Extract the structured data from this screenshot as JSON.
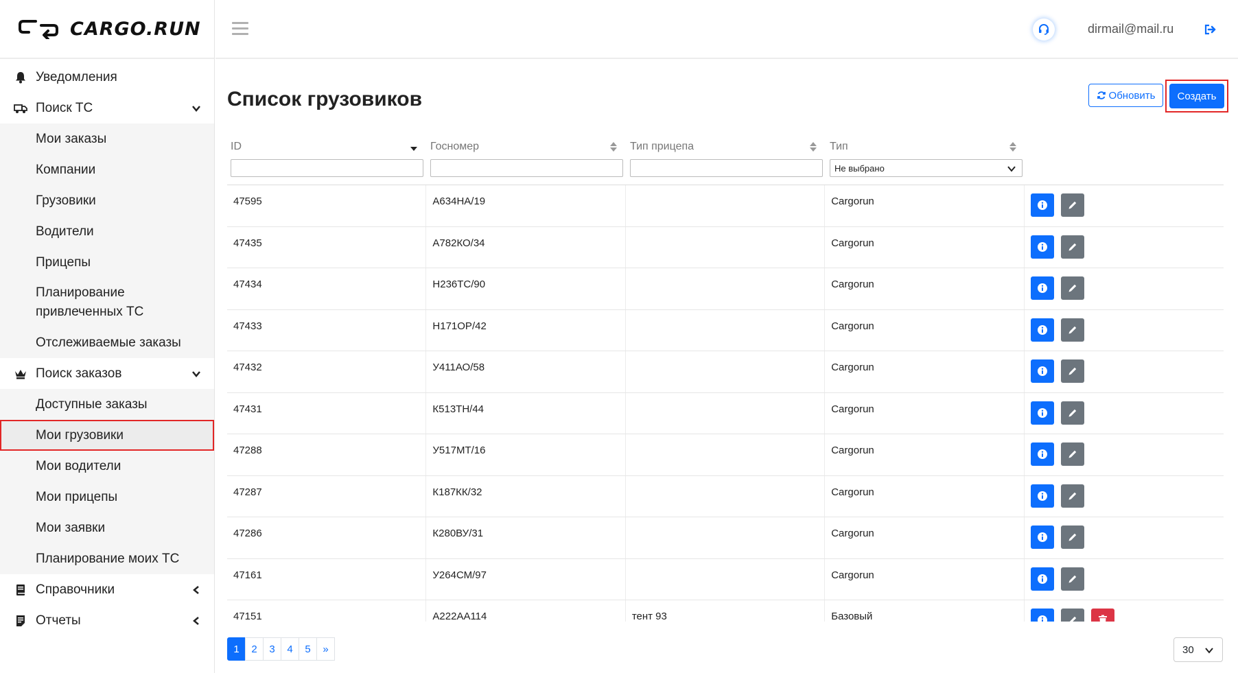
{
  "brand": {
    "name": "CARGO.RUN"
  },
  "sidebar": {
    "items": [
      {
        "label": "Уведомления",
        "icon": "bell-icon"
      },
      {
        "label": "Поиск ТС",
        "icon": "truck-search-icon",
        "expanded": true,
        "children": [
          "Мои заказы",
          "Компании",
          "Грузовики",
          "Водители",
          "Прицепы",
          "Планирование привлеченных ТС",
          "Отслеживаемые заказы"
        ]
      },
      {
        "label": "Поиск заказов",
        "icon": "crown-icon",
        "expanded": true,
        "children": [
          "Доступные заказы",
          "Мои грузовики",
          "Мои водители",
          "Мои прицепы",
          "Мои заявки",
          "Планирование моих ТС"
        ]
      },
      {
        "label": "Справочники",
        "icon": "book-icon",
        "expanded": false
      },
      {
        "label": "Отчеты",
        "icon": "report-icon",
        "expanded": false
      }
    ],
    "active_item": "Мои грузовики"
  },
  "header": {
    "user_email": "dirmail@mail.ru"
  },
  "page": {
    "title": "Список грузовиков",
    "refresh_label": "Обновить",
    "create_label": "Создать"
  },
  "table": {
    "columns": [
      "ID",
      "Госномер",
      "Тип прицепа",
      "Тип"
    ],
    "type_filter_value": "Не выбрано",
    "rows": [
      {
        "id": "47595",
        "plate": "А634НА/19",
        "trailer": "",
        "type": "Cargorun"
      },
      {
        "id": "47435",
        "plate": "А782КО/34",
        "trailer": "",
        "type": "Cargorun"
      },
      {
        "id": "47434",
        "plate": "Н236ТС/90",
        "trailer": "",
        "type": "Cargorun"
      },
      {
        "id": "47433",
        "plate": "Н171ОР/42",
        "trailer": "",
        "type": "Cargorun"
      },
      {
        "id": "47432",
        "plate": "У411АО/58",
        "trailer": "",
        "type": "Cargorun"
      },
      {
        "id": "47431",
        "plate": "К513ТН/44",
        "trailer": "",
        "type": "Cargorun"
      },
      {
        "id": "47288",
        "plate": "У517МТ/16",
        "trailer": "",
        "type": "Cargorun"
      },
      {
        "id": "47287",
        "plate": "К187КК/32",
        "trailer": "",
        "type": "Cargorun"
      },
      {
        "id": "47286",
        "plate": "К280ВУ/31",
        "trailer": "",
        "type": "Cargorun"
      },
      {
        "id": "47161",
        "plate": "У264СМ/97",
        "trailer": "",
        "type": "Cargorun"
      },
      {
        "id": "47151",
        "plate": "А222АА114",
        "trailer": "тент 93",
        "type": "Базовый"
      }
    ]
  },
  "pagination": {
    "pages": [
      "1",
      "2",
      "3",
      "4",
      "5"
    ],
    "next": "»",
    "current": "1",
    "page_size": "30"
  },
  "colors": {
    "primary": "#0d6efd",
    "secondary": "#6c757d",
    "danger": "#dc3545",
    "highlight": "#e22626"
  }
}
